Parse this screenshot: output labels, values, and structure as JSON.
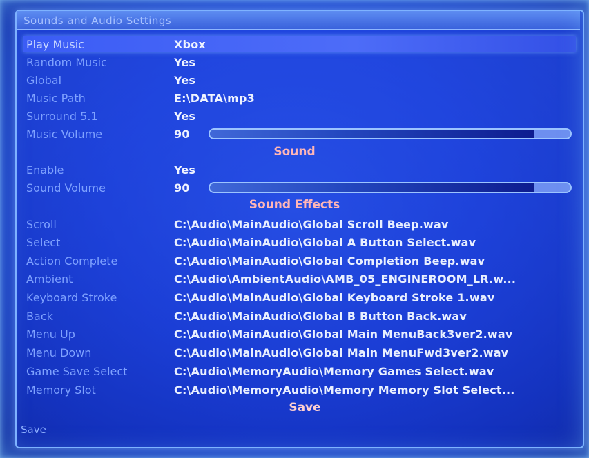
{
  "title": "Sounds and Audio Settings",
  "music": [
    {
      "label": "Play Music",
      "value": "Xbox",
      "selected": true
    },
    {
      "label": "Random Music",
      "value": "Yes"
    },
    {
      "label": "Global",
      "value": "Yes"
    },
    {
      "label": "Music Path",
      "value": "E:\\DATA\\mp3"
    },
    {
      "label": "Surround 5.1",
      "value": "Yes"
    },
    {
      "label": "Music Volume",
      "value": "90",
      "level_percent": 90
    }
  ],
  "sound_header": "Sound",
  "sound": [
    {
      "label": "Enable",
      "value": "Yes"
    },
    {
      "label": "Sound Volume",
      "value": "90",
      "level_percent": 90
    }
  ],
  "effects_header": "Sound Effects",
  "effects": [
    {
      "label": "Scroll",
      "value": "C:\\Audio\\MainAudio\\Global Scroll Beep.wav"
    },
    {
      "label": "Select",
      "value": "C:\\Audio\\MainAudio\\Global A Button Select.wav"
    },
    {
      "label": "Action Complete",
      "value": "C:\\Audio\\MainAudio\\Global Completion Beep.wav"
    },
    {
      "label": "Ambient",
      "value": "C:\\Audio\\AmbientAudio\\AMB_05_ENGINEROOM_LR.w..."
    },
    {
      "label": "Keyboard Stroke",
      "value": "C:\\Audio\\MainAudio\\Global Keyboard Stroke 1.wav"
    },
    {
      "label": "Back",
      "value": "C:\\Audio\\MainAudio\\Global B Button Back.wav"
    },
    {
      "label": "Menu Up",
      "value": "C:\\Audio\\MainAudio\\Global Main MenuBack3ver2.wav"
    },
    {
      "label": "Menu Down",
      "value": "C:\\Audio\\MainAudio\\Global Main MenuFwd3ver2.wav"
    },
    {
      "label": "Game Save Select",
      "value": "C:\\Audio\\MemoryAudio\\Memory Games Select.wav"
    },
    {
      "label": "Memory Slot",
      "value": "C:\\Audio\\MemoryAudio\\Memory Memory Slot Select..."
    }
  ],
  "save_button": "Save",
  "footer_status": "Save"
}
